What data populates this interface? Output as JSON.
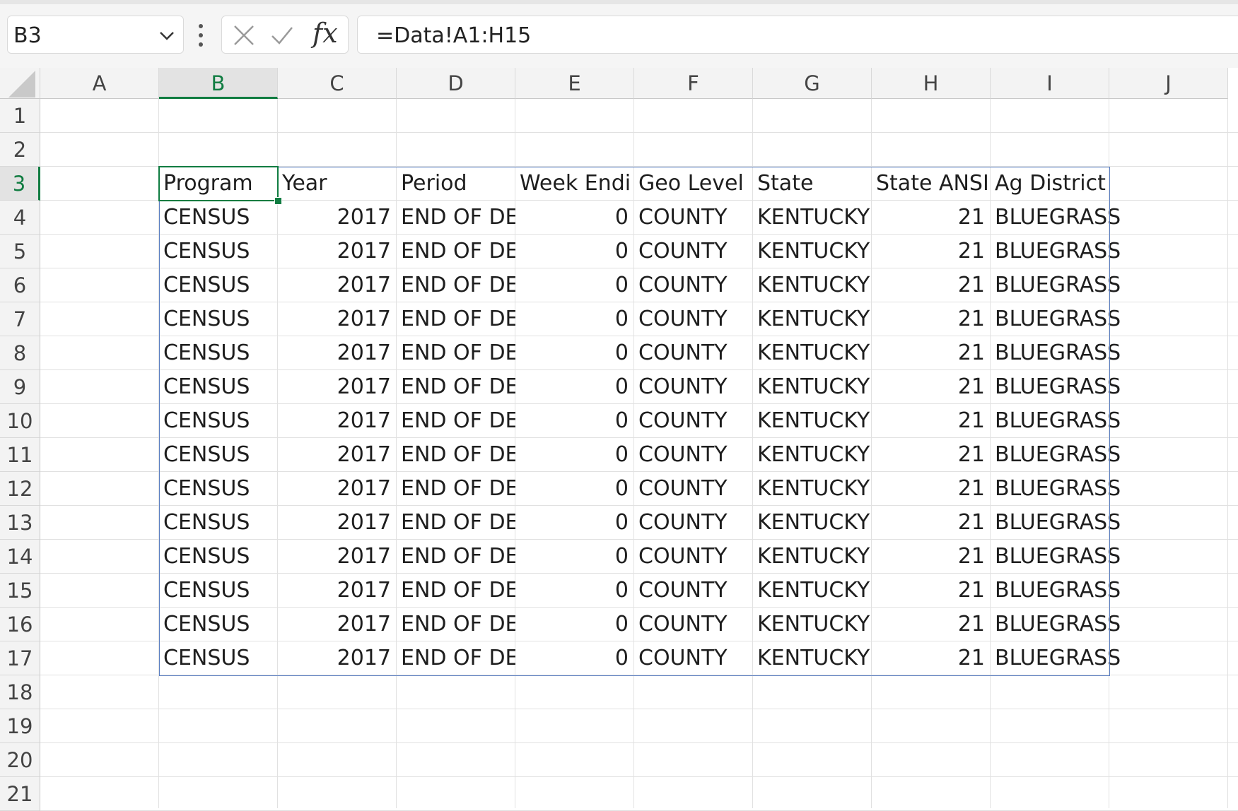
{
  "name_box": {
    "value": "B3"
  },
  "formula_bar": {
    "formula": "=Data!A1:H15"
  },
  "icons": [
    "chevron-down-icon",
    "more-options-icon",
    "cancel-icon",
    "enter-icon",
    "insert-function-icon"
  ],
  "accent_color": "#107c41",
  "range_border_color": "#5b7fc2",
  "columns": [
    "A",
    "B",
    "C",
    "D",
    "E",
    "F",
    "G",
    "H",
    "I",
    "J"
  ],
  "selected_column": "B",
  "rows": [
    "1",
    "2",
    "3",
    "4",
    "5",
    "6",
    "7",
    "8",
    "9",
    "10",
    "11",
    "12",
    "13",
    "14",
    "15",
    "16",
    "17",
    "18",
    "19",
    "20",
    "21"
  ],
  "selected_row": "3",
  "table": {
    "headers": [
      "Program",
      "Year",
      "Period",
      "Week Endi",
      "Geo Level",
      "State",
      "State ANSI",
      "Ag District"
    ],
    "rows": [
      [
        "CENSUS",
        "2017",
        "END OF DE",
        "0",
        "COUNTY",
        "KENTUCKY",
        "21",
        "BLUEGRASS"
      ],
      [
        "CENSUS",
        "2017",
        "END OF DE",
        "0",
        "COUNTY",
        "KENTUCKY",
        "21",
        "BLUEGRASS"
      ],
      [
        "CENSUS",
        "2017",
        "END OF DE",
        "0",
        "COUNTY",
        "KENTUCKY",
        "21",
        "BLUEGRASS"
      ],
      [
        "CENSUS",
        "2017",
        "END OF DE",
        "0",
        "COUNTY",
        "KENTUCKY",
        "21",
        "BLUEGRASS"
      ],
      [
        "CENSUS",
        "2017",
        "END OF DE",
        "0",
        "COUNTY",
        "KENTUCKY",
        "21",
        "BLUEGRASS"
      ],
      [
        "CENSUS",
        "2017",
        "END OF DE",
        "0",
        "COUNTY",
        "KENTUCKY",
        "21",
        "BLUEGRASS"
      ],
      [
        "CENSUS",
        "2017",
        "END OF DE",
        "0",
        "COUNTY",
        "KENTUCKY",
        "21",
        "BLUEGRASS"
      ],
      [
        "CENSUS",
        "2017",
        "END OF DE",
        "0",
        "COUNTY",
        "KENTUCKY",
        "21",
        "BLUEGRASS"
      ],
      [
        "CENSUS",
        "2017",
        "END OF DE",
        "0",
        "COUNTY",
        "KENTUCKY",
        "21",
        "BLUEGRASS"
      ],
      [
        "CENSUS",
        "2017",
        "END OF DE",
        "0",
        "COUNTY",
        "KENTUCKY",
        "21",
        "BLUEGRASS"
      ],
      [
        "CENSUS",
        "2017",
        "END OF DE",
        "0",
        "COUNTY",
        "KENTUCKY",
        "21",
        "BLUEGRASS"
      ],
      [
        "CENSUS",
        "2017",
        "END OF DE",
        "0",
        "COUNTY",
        "KENTUCKY",
        "21",
        "BLUEGRASS"
      ],
      [
        "CENSUS",
        "2017",
        "END OF DE",
        "0",
        "COUNTY",
        "KENTUCKY",
        "21",
        "BLUEGRASS"
      ],
      [
        "CENSUS",
        "2017",
        "END OF DE",
        "0",
        "COUNTY",
        "KENTUCKY",
        "21",
        "BLUEGRASS"
      ]
    ]
  }
}
